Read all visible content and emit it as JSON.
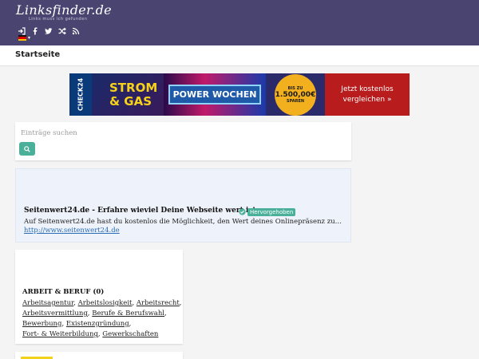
{
  "header": {
    "logo_text": "Linksfinder.de",
    "tagline": "Links muss ich gefunden",
    "icons": [
      "login-icon",
      "facebook-icon",
      "twitter-icon",
      "shuffle-icon",
      "rss-icon"
    ],
    "language": "de",
    "bg_color": "#4a4570"
  },
  "nav": {
    "home_label": "Startseite"
  },
  "banner": {
    "brand": "CHECK24",
    "product_line1": "STROM",
    "product_line2": "& GAS",
    "campaign": "POWER WOCHEN",
    "savings_prefix": "BIS ZU",
    "savings_value": "1.500,00€",
    "savings_suffix": "SPAREN",
    "cta": "Jetzt kostenlos vergleichen »"
  },
  "search": {
    "placeholder": "Einträge suchen"
  },
  "featured": {
    "title": "Seitenwert24.de - Erfahre wieviel Deine Webseite wert ist.",
    "badge": "Hervorgehoben",
    "description": "Auf Seitenwert24.de hast du kostenlos die Möglichkeit, den Wert deines Onlinepräsenz zu...",
    "url": "http://www.seitenwert24.de"
  },
  "category": {
    "title": "ARBEIT & BERUF (0)",
    "links": [
      "Arbeitsagentur",
      "Arbeitslosigkeit",
      "Arbeitsrecht",
      "Arbeitsvermittlung",
      "Berufe & Berufswahl",
      "Bewerbung",
      "Existenzgründung",
      "Fort- & Weiterbildung",
      "Gewerkschaften"
    ]
  },
  "colors": {
    "accent": "#4ab09a",
    "link": "#2a6db5"
  }
}
